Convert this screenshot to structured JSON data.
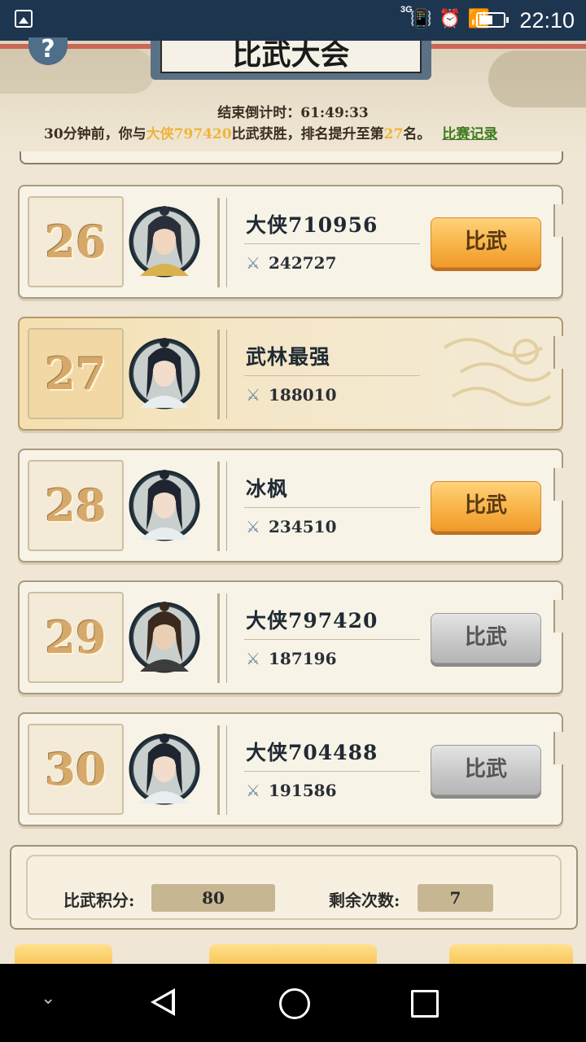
{
  "status_bar": {
    "time": "22:10",
    "network": "3G",
    "icons": [
      "gallery-icon",
      "vibrate-icon",
      "alarm-icon",
      "wifi-icon",
      "signal-icon",
      "battery-icon"
    ]
  },
  "header": {
    "title": "比武大会",
    "help_label": "?",
    "countdown_label": "结束倒计时：",
    "countdown_value": "61:49:33",
    "notice": {
      "prefix": "30分钟前，你与",
      "opponent": "大侠797420",
      "middle": "比武获胜，排名提升至第",
      "rank": "27",
      "suffix": "名。",
      "record_link": "比赛记录"
    }
  },
  "rankings": [
    {
      "rank": "26",
      "name": "大侠710956",
      "power": "242727",
      "button": "比武",
      "button_state": "active",
      "is_self": false
    },
    {
      "rank": "27",
      "name": "武林最强",
      "power": "188010",
      "button": "",
      "button_state": "none",
      "is_self": true
    },
    {
      "rank": "28",
      "name": "冰枫",
      "power": "234510",
      "button": "比武",
      "button_state": "active",
      "is_self": false
    },
    {
      "rank": "29",
      "name": "大侠797420",
      "power": "187196",
      "button": "比武",
      "button_state": "disabled",
      "is_self": false
    },
    {
      "rank": "30",
      "name": "大侠704488",
      "power": "191586",
      "button": "比武",
      "button_state": "disabled",
      "is_self": false
    }
  ],
  "footer": {
    "score_label": "比武积分:",
    "score_value": "80",
    "remaining_label": "剩余次数:",
    "remaining_value": "7"
  },
  "colors": {
    "accent_gold": "#f0b43a",
    "link_green": "#3f7a1e",
    "active_button": "#f8b347",
    "disabled_button": "#c8c8c8",
    "status_bar": "#1e3550"
  }
}
